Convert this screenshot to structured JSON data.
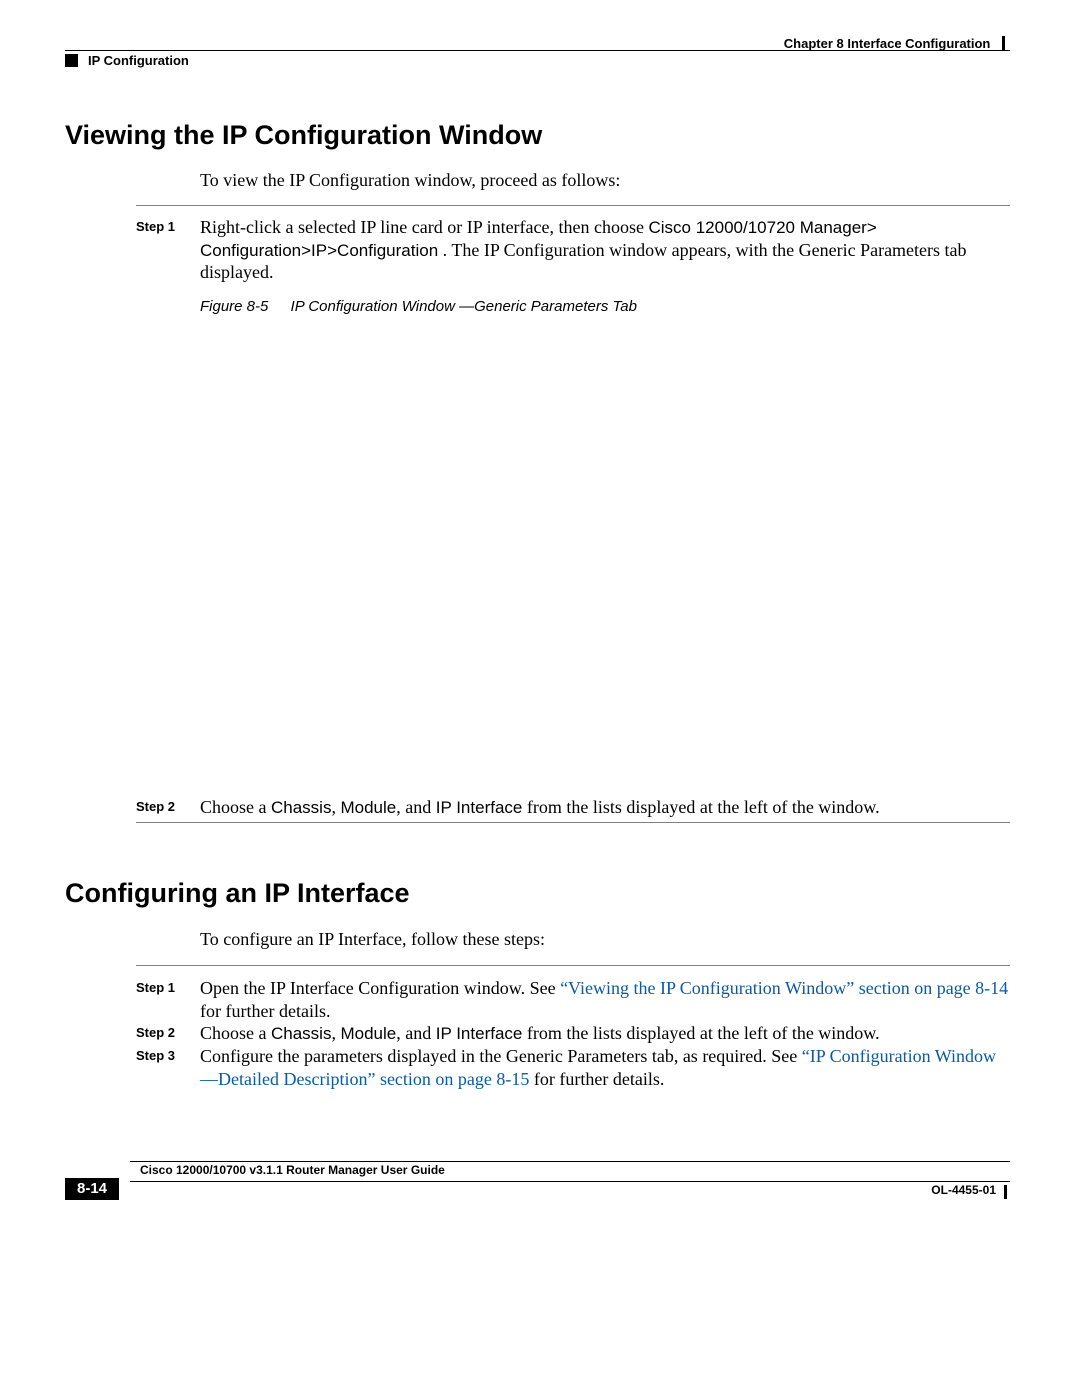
{
  "header": {
    "chapter_label": "Chapter 8",
    "chapter_prefix": "Chapter 8    ",
    "chapter_title": "Interface Configuration",
    "section_current": "IP Configuration"
  },
  "sections": {
    "view": {
      "title": "Viewing the IP Configuration Window",
      "intro": "To view the IP Configuration window, proceed as follows:",
      "steps": {
        "s1": {
          "label": "Step 1",
          "before": "Right-click a selected IP line card or IP interface, then choose ",
          "cmd": "Cisco 12000/10720 Manager> Configuration>IP>Configuration",
          "after": " . The IP Configuration window appears, with the Generic Parameters tab displayed."
        },
        "s2": {
          "label": "Step 2",
          "before": "Choose a ",
          "t1": "Chassis",
          "mid1": ", ",
          "t2": "Module",
          "mid2": ", and ",
          "t3": "IP Interface",
          "after": " from the lists displayed at the left of the window."
        }
      },
      "figure": {
        "label": "Figure 8-5",
        "title": "IP Configuration Window    —Generic Parameters Tab"
      }
    },
    "config": {
      "title": "Configuring an IP Interface",
      "intro": "To configure an IP Interface, follow these steps:",
      "steps": {
        "s1": {
          "label": "Step 1",
          "before": "Open the IP Interface Configuration window. See ",
          "link": "“Viewing the IP Configuration Window” section on page 8-14",
          "after": " for further details."
        },
        "s2": {
          "label": "Step 2",
          "before": "Choose a ",
          "t1": "Chassis",
          "mid1": ", ",
          "t2": "Module",
          "mid2": ", and ",
          "t3": "IP Interface",
          "after": " from the lists displayed at the left of the window."
        },
        "s3": {
          "label": "Step 3",
          "before": "Configure the parameters displayed in the Generic Parameters tab, as required. See ",
          "link": "“IP Configuration Window—Detailed Description” section on page 8-15",
          "after": " for further details."
        }
      }
    }
  },
  "footer": {
    "guide": "Cisco 12000/10700 v3.1.1 Router Manager User Guide",
    "page": "8-14",
    "docnum": "OL-4455-01"
  }
}
